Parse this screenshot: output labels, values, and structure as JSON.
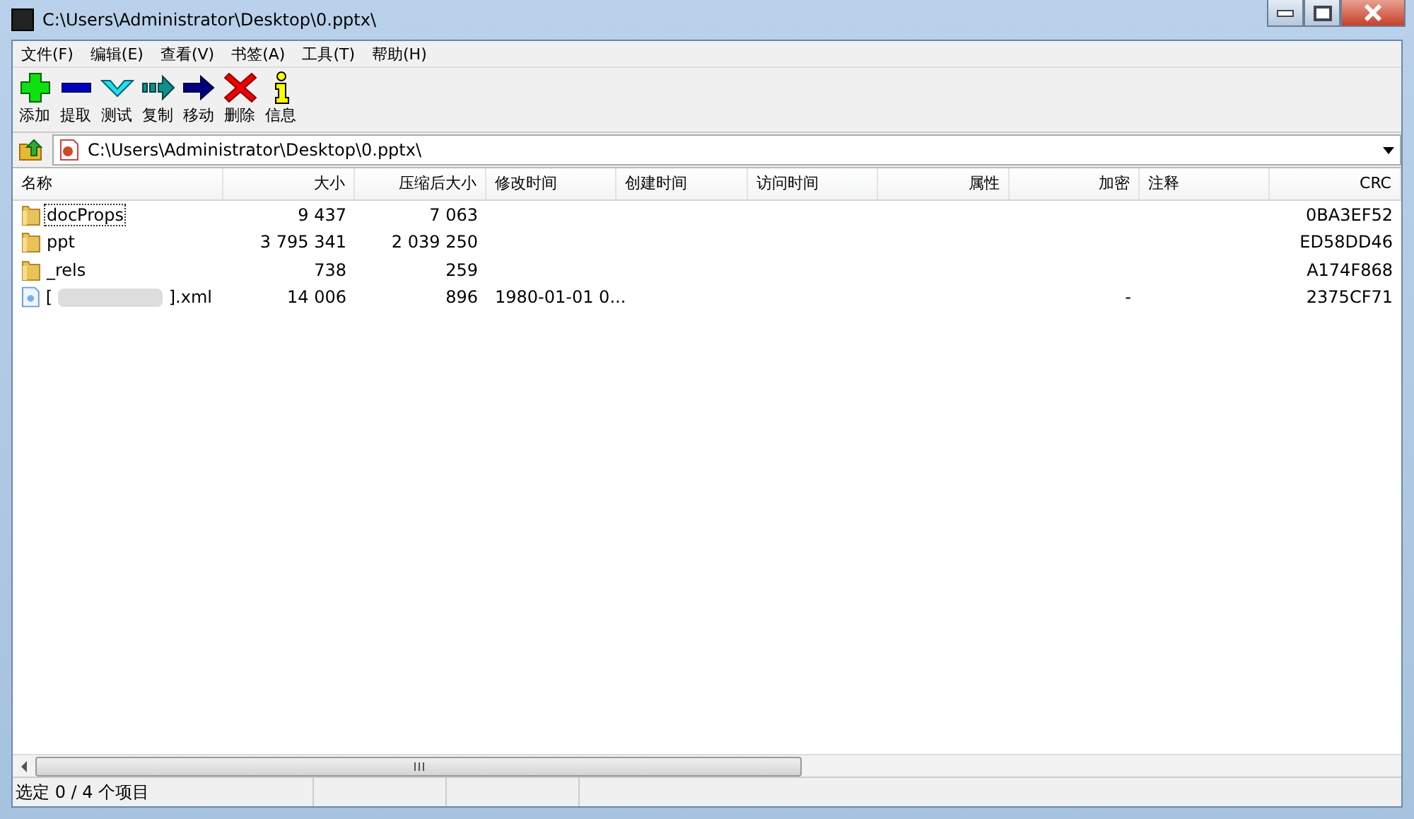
{
  "window": {
    "title": "C:\\Users\\Administrator\\Desktop\\0.pptx\\"
  },
  "menu": [
    "文件(F)",
    "编辑(E)",
    "查看(V)",
    "书签(A)",
    "工具(T)",
    "帮助(H)"
  ],
  "toolbar": [
    {
      "kind": "add",
      "label": "添加"
    },
    {
      "kind": "extract",
      "label": "提取"
    },
    {
      "kind": "test",
      "label": "测试"
    },
    {
      "kind": "copy",
      "label": "复制"
    },
    {
      "kind": "move",
      "label": "移动"
    },
    {
      "kind": "delete",
      "label": "删除"
    },
    {
      "kind": "info",
      "label": "信息"
    }
  ],
  "address": {
    "value": "C:\\Users\\Administrator\\Desktop\\0.pptx\\"
  },
  "table": {
    "columns": [
      "名称",
      "大小",
      "压缩后大小",
      "修改时间",
      "创建时间",
      "访问时间",
      "属性",
      "加密",
      "注释",
      "CRC"
    ],
    "rows": [
      {
        "kind": "folder",
        "focused": true,
        "cells": [
          "docProps",
          "9 437",
          "7 063",
          "",
          "",
          "",
          "",
          "",
          "",
          "0BA3EF52"
        ]
      },
      {
        "kind": "folder",
        "focused": false,
        "cells": [
          "ppt",
          "3 795 341",
          "2 039 250",
          "",
          "",
          "",
          "",
          "",
          "",
          "ED58DD46"
        ]
      },
      {
        "kind": "folder",
        "focused": false,
        "cells": [
          "_rels",
          "738",
          "259",
          "",
          "",
          "",
          "",
          "",
          "",
          "A174F868"
        ]
      },
      {
        "kind": "file",
        "focused": false,
        "blurred": true,
        "name_end": "].xml",
        "cells": [
          "[",
          "14 006",
          "896",
          "1980-01-01 0...",
          "",
          "",
          "",
          "-",
          "",
          "2375CF71"
        ]
      }
    ]
  },
  "status_bar": "选定 0 / 4 个项目"
}
